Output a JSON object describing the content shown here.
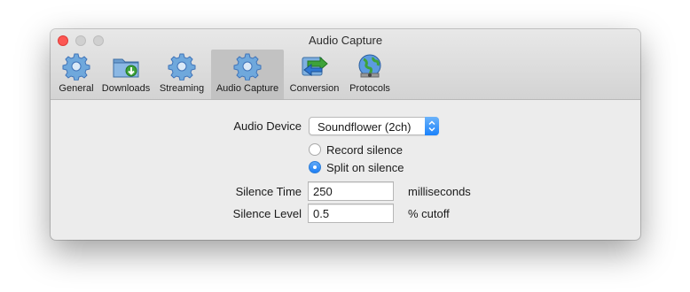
{
  "window": {
    "title": "Audio Capture"
  },
  "tabs": [
    {
      "label": "General",
      "icon": "gear-icon",
      "selected": false
    },
    {
      "label": "Downloads",
      "icon": "downloads-folder-icon",
      "selected": false
    },
    {
      "label": "Streaming",
      "icon": "gear-icon",
      "selected": false
    },
    {
      "label": "Audio Capture",
      "icon": "gear-icon",
      "selected": true
    },
    {
      "label": "Conversion",
      "icon": "conversion-arrows-icon",
      "selected": false
    },
    {
      "label": "Protocols",
      "icon": "globe-icon",
      "selected": false
    }
  ],
  "form": {
    "audio_device_label": "Audio Device",
    "audio_device_value": "Soundflower (2ch)",
    "record_silence_label": "Record silence",
    "split_on_silence_label": "Split on silence",
    "selected_option": "Split on silence",
    "silence_time_label": "Silence Time",
    "silence_time_value": "250",
    "silence_time_unit": "milliseconds",
    "silence_level_label": "Silence Level",
    "silence_level_value": "0.5",
    "silence_level_unit": "% cutoff"
  },
  "colors": {
    "accent": "#1a82fb",
    "close": "#fc5753",
    "toolbar_selected": "#c2c2c2"
  }
}
